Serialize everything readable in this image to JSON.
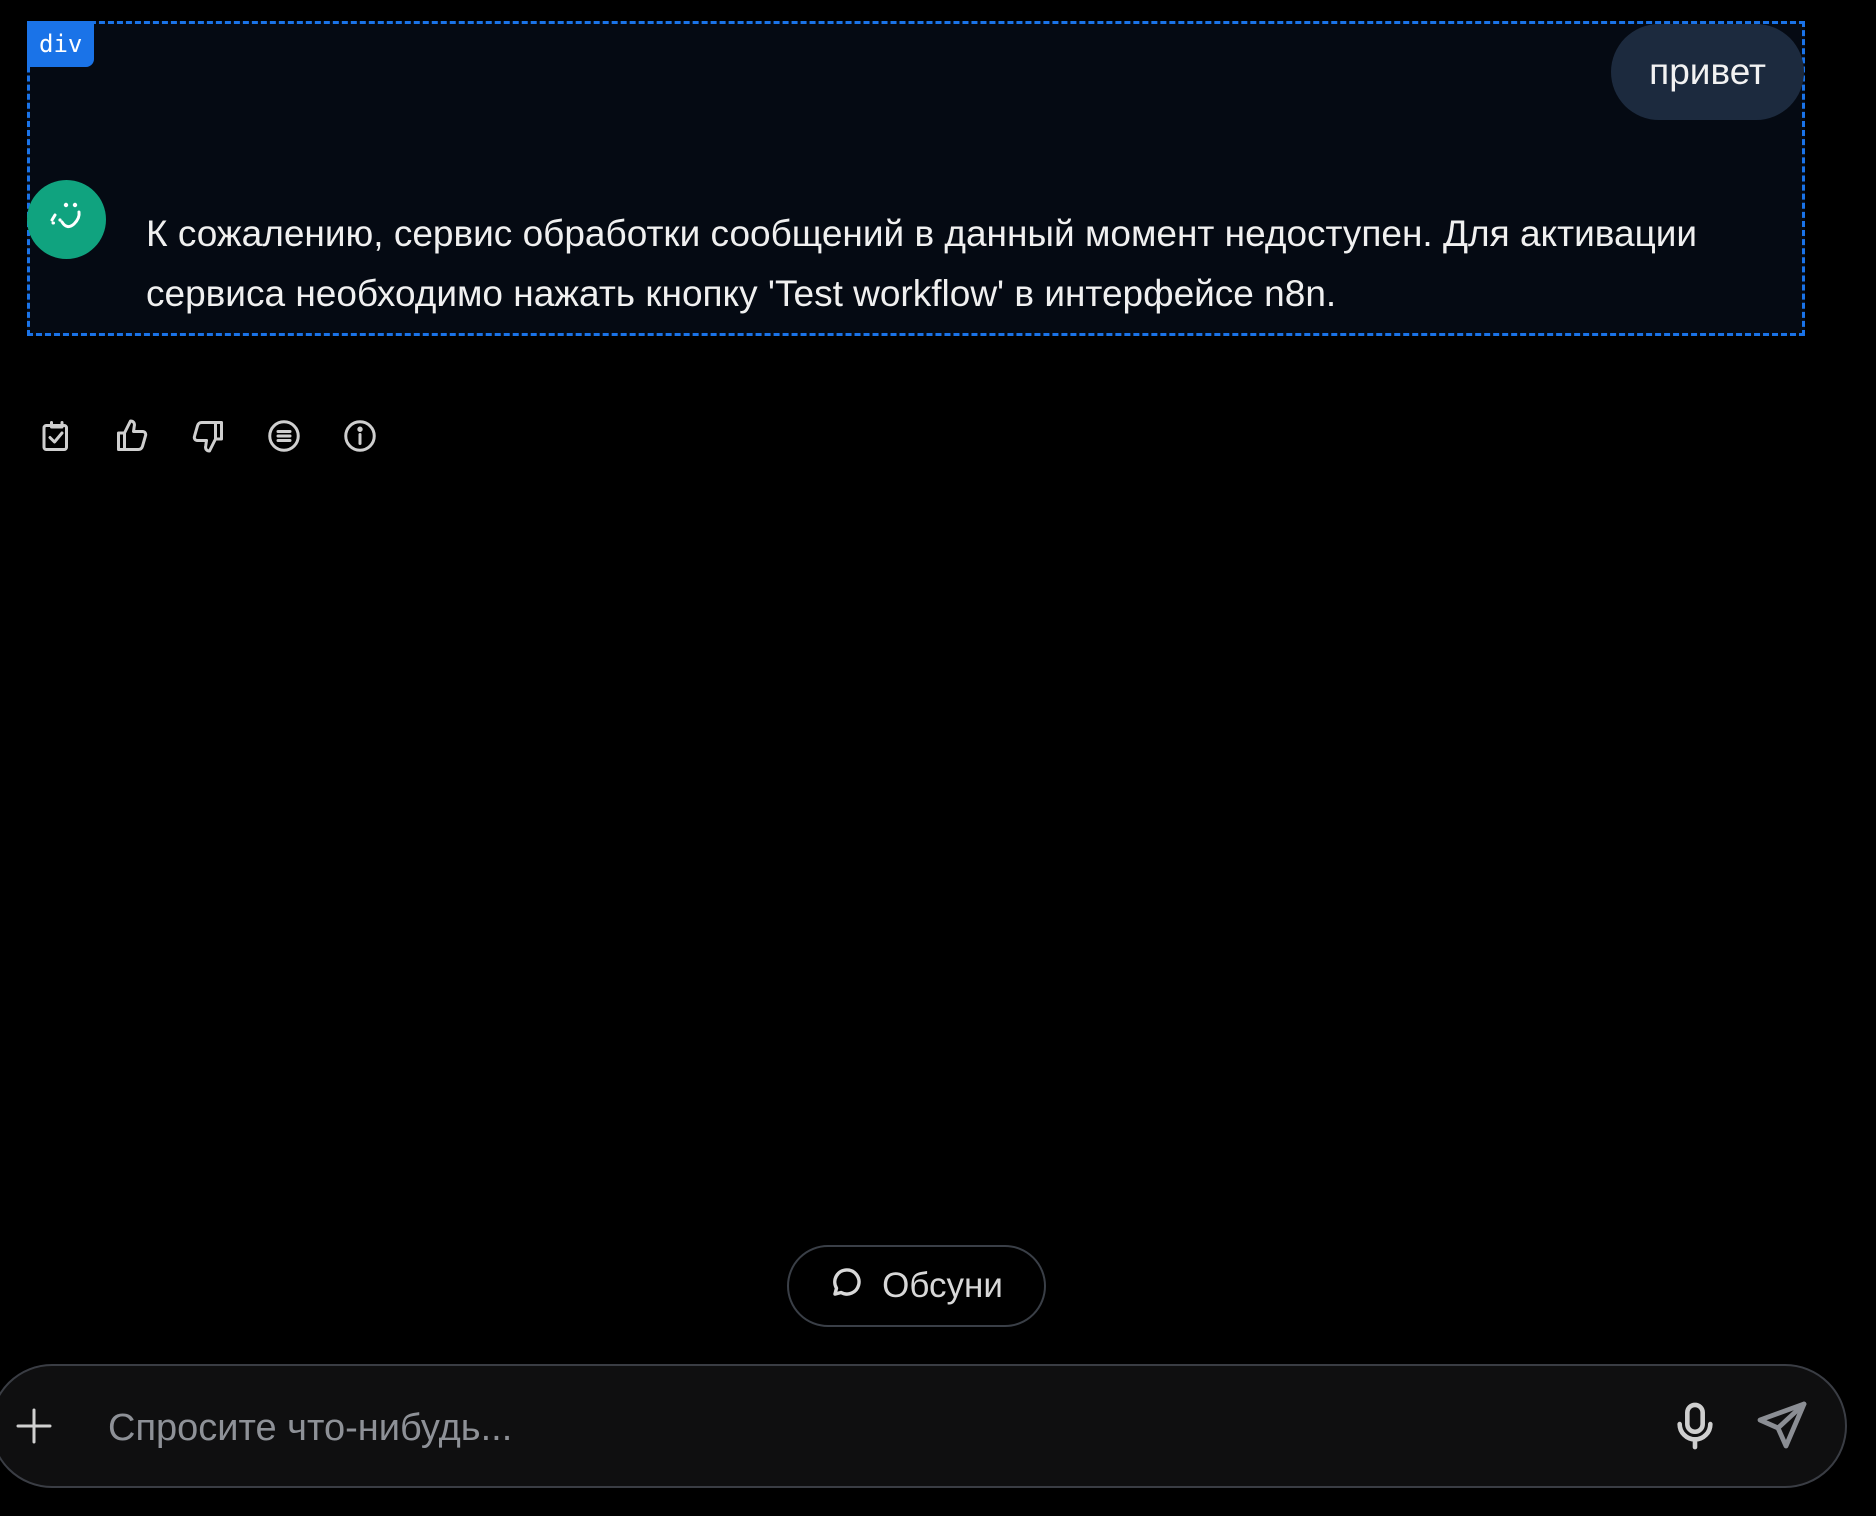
{
  "devtools": {
    "tag_label": "div",
    "highlight_color": "#1a73e8"
  },
  "messages": {
    "user": {
      "text": "привет"
    },
    "assistant": {
      "avatar_icon": "bot-face-icon",
      "avatar_color": "#10a37f",
      "text": "К сожалению, сервис обработки сообщений в данный момент недоступен. Для активации сервиса необходимо нажать кнопку 'Test workflow' в интерфейсе n8n."
    }
  },
  "message_actions": [
    {
      "icon": "copy-check-icon"
    },
    {
      "icon": "thumbs-up-icon"
    },
    {
      "icon": "thumbs-down-icon"
    },
    {
      "icon": "list-circle-icon"
    },
    {
      "icon": "info-icon"
    }
  ],
  "discuss": {
    "icon": "chat-bubble-icon",
    "label": "Обсуни"
  },
  "composer": {
    "placeholder": "Спросите что-нибудь...",
    "value": "",
    "plus_icon": "plus-icon",
    "mic_icon": "microphone-icon",
    "send_icon": "send-icon"
  }
}
